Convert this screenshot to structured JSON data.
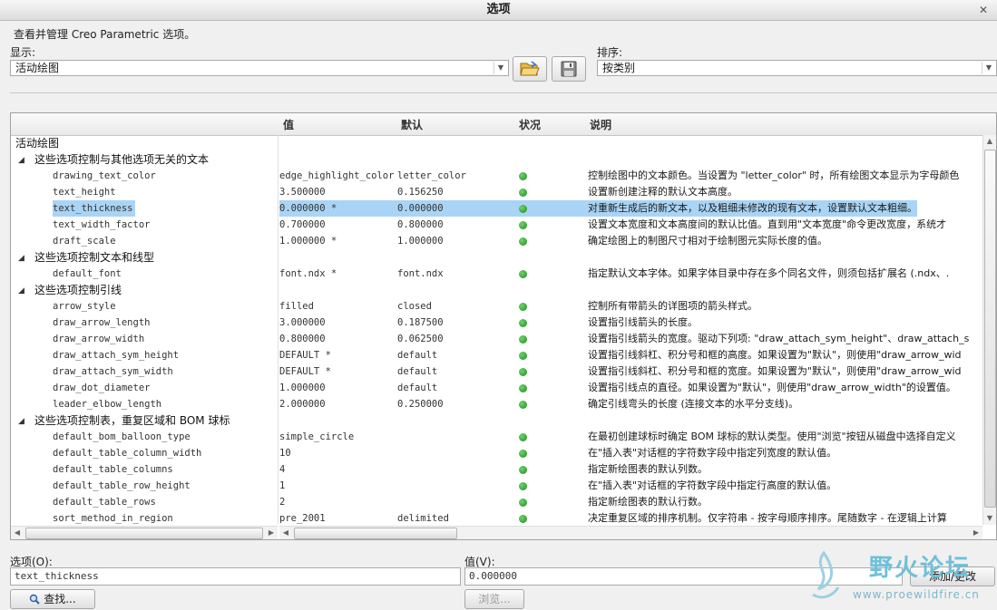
{
  "window": {
    "title": "选项",
    "close_glyph": "✕"
  },
  "intro_text": "查看并管理 Creo Parametric 选项。",
  "show": {
    "label": "显示:",
    "value": "活动绘图"
  },
  "sort": {
    "label": "排序:",
    "value": "按类别"
  },
  "table": {
    "columns": {
      "value": "值",
      "default": "默认",
      "status": "状况",
      "description": "说明"
    },
    "status_color": "#1b8c1b",
    "highlight_color": "#a9d4f5",
    "rows": [
      {
        "type": "root",
        "name": "活动绘图"
      },
      {
        "type": "group",
        "name": "这些选项控制与其他选项无关的文本"
      },
      {
        "type": "option",
        "name": "drawing_text_color",
        "value": "edge_highlight_color",
        "default": "letter_color",
        "status": "ok",
        "description": "控制绘图中的文本颜色。当设置为 \"letter_color\" 时，所有绘图文本显示为字母颜色"
      },
      {
        "type": "option",
        "name": "text_height",
        "value": "3.500000",
        "default": "0.156250",
        "status": "ok",
        "description": "设置新创建注释的默认文本高度。"
      },
      {
        "type": "option",
        "name": "text_thickness",
        "value": "0.000000 *",
        "default": "0.000000",
        "status": "ok",
        "description": "对重新生成后的新文本，以及粗细未修改的现有文本，设置默认文本粗细。",
        "selected": true
      },
      {
        "type": "option",
        "name": "text_width_factor",
        "value": "0.700000",
        "default": "0.800000",
        "status": "ok",
        "description": "设置文本宽度和文本高度间的默认比值。直到用\"文本宽度\"命令更改宽度，系统才",
        "selected": false
      },
      {
        "type": "option",
        "name": "draft_scale",
        "value": "1.000000 *",
        "default": "1.000000",
        "status": "ok",
        "description": "确定绘图上的制图尺寸相对于绘制图元实际长度的值。"
      },
      {
        "type": "group",
        "name": "这些选项控制文本和线型"
      },
      {
        "type": "option",
        "name": "default_font",
        "value": "font.ndx *",
        "default": "font.ndx",
        "status": "ok",
        "description": "指定默认文本字体。如果字体目录中存在多个同名文件，则须包括扩展名 (.ndx、."
      },
      {
        "type": "group",
        "name": "这些选项控制引线"
      },
      {
        "type": "option",
        "name": "arrow_style",
        "value": "filled",
        "default": "closed",
        "status": "ok",
        "description": "控制所有带箭头的详图项的箭头样式。"
      },
      {
        "type": "option",
        "name": "draw_arrow_length",
        "value": "3.000000",
        "default": "0.187500",
        "status": "ok",
        "description": "设置指引线箭头的长度。"
      },
      {
        "type": "option",
        "name": "draw_arrow_width",
        "value": "0.800000",
        "default": "0.062500",
        "status": "ok",
        "description": "设置指引线箭头的宽度。驱动下列项: \"draw_attach_sym_height\"、draw_attach_s"
      },
      {
        "type": "option",
        "name": "draw_attach_sym_height",
        "value": "DEFAULT *",
        "default": "default",
        "status": "ok",
        "description": "设置指引线斜杠、积分号和框的高度。如果设置为\"默认\"，则使用\"draw_arrow_wid"
      },
      {
        "type": "option",
        "name": "draw_attach_sym_width",
        "value": "DEFAULT *",
        "default": "default",
        "status": "ok",
        "description": "设置指引线斜杠、积分号和框的宽度。如果设置为\"默认\"，则使用\"draw_arrow_wid"
      },
      {
        "type": "option",
        "name": "draw_dot_diameter",
        "value": "1.000000",
        "default": "default",
        "status": "ok",
        "description": "设置指引线点的直径。如果设置为\"默认\"，则使用\"draw_arrow_width\"的设置值。"
      },
      {
        "type": "option",
        "name": "leader_elbow_length",
        "value": "2.000000",
        "default": "0.250000",
        "status": "ok",
        "description": "确定引线弯头的长度 (连接文本的水平分支线)。"
      },
      {
        "type": "group",
        "name": "这些选项控制表，重复区域和 BOM 球标"
      },
      {
        "type": "option",
        "name": "default_bom_balloon_type",
        "value": "simple_circle",
        "default": "",
        "status": "ok",
        "description": "在最初创建球标时确定 BOM 球标的默认类型。使用\"浏览\"按钮从磁盘中选择自定义"
      },
      {
        "type": "option",
        "name": "default_table_column_width",
        "value": "10",
        "default": "",
        "status": "ok",
        "description": "在\"插入表\"对话框的字符数字段中指定列宽度的默认值。"
      },
      {
        "type": "option",
        "name": "default_table_columns",
        "value": "4",
        "default": "",
        "status": "ok",
        "description": "指定新绘图表的默认列数。"
      },
      {
        "type": "option",
        "name": "default_table_row_height",
        "value": "1",
        "default": "",
        "status": "ok",
        "description": "在\"插入表\"对话框的字符数字段中指定行高度的默认值。"
      },
      {
        "type": "option",
        "name": "default_table_rows",
        "value": "2",
        "default": "",
        "status": "ok",
        "description": "指定新绘图表的默认行数。"
      },
      {
        "type": "option",
        "name": "sort_method_in_region",
        "value": "pre_2001",
        "default": "delimited",
        "status": "ok",
        "description": "决定重复区域的排序机制。仅字符串 - 按字母顺序排序。尾随数字 - 在逻辑上计算"
      }
    ]
  },
  "bottom": {
    "option_label": "选项(O):",
    "option_value": "text_thickness",
    "value_label": "值(V):",
    "value_value": "0.000000",
    "add_change_label": "添加/更改",
    "find_label": "查找...",
    "browse_label": "浏览..."
  },
  "watermark": {
    "brand": "野火论坛",
    "url": "www.proewildfire.cn"
  }
}
